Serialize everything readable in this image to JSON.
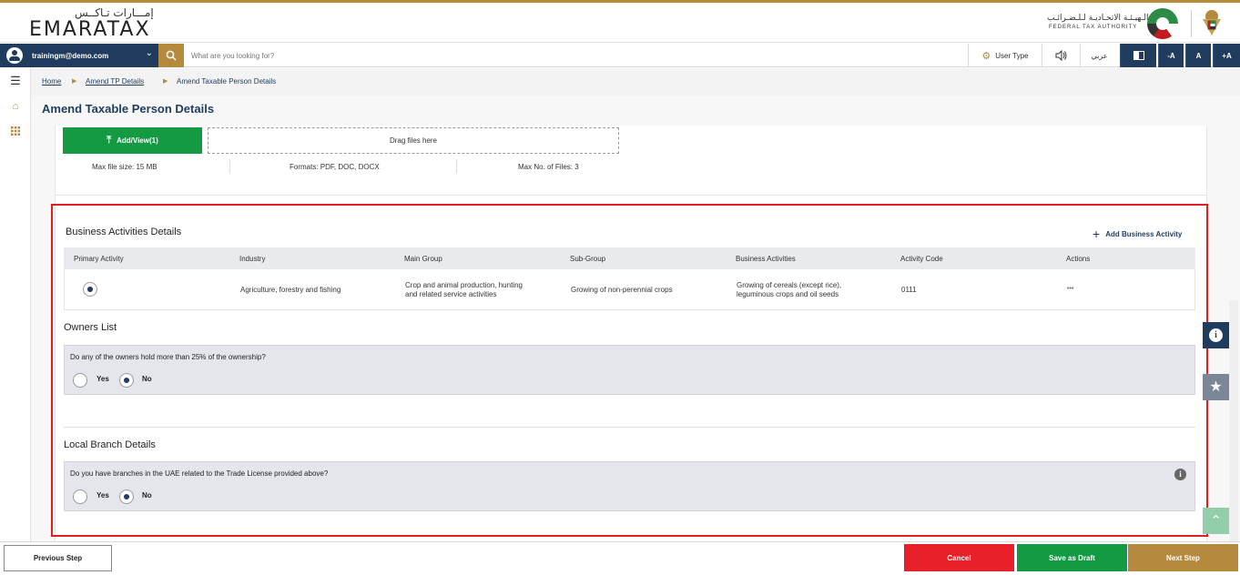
{
  "header": {
    "logo_ar": "إمـــارات تـاكــس",
    "logo_en": "EMARATAX",
    "fta_ar": "الـهيـئـة الاتحـاديـة لـلـضـرائـب",
    "fta_en": "FEDERAL TAX AUTHORITY"
  },
  "navbar": {
    "user_email": "trainingm@demo.com",
    "search_placeholder": "What are you looking for?",
    "user_type_label": "User Type",
    "arabic_label": "عربي",
    "font_decrease": "-A",
    "font_normal": "A",
    "font_increase": "+A"
  },
  "breadcrumb": {
    "home": "Home",
    "amend_tp": "Amend TP Details",
    "current": "Amend Taxable Person Details"
  },
  "page": {
    "title": "Amend Taxable Person Details"
  },
  "upload": {
    "button_label": "Add/View(1)",
    "drop_text": "Drag files here",
    "max_size": "Max file size: 15 MB",
    "formats": "Formats: PDF, DOC, DOCX",
    "max_files": "Max No. of Files: 3"
  },
  "business": {
    "title": "Business Activities Details",
    "add_label": "Add Business Activity",
    "columns": [
      "Primary Activity",
      "Industry",
      "Main Group",
      "Sub-Group",
      "Business Activities",
      "Activity Code",
      "Actions"
    ],
    "row": {
      "primary_selected": true,
      "industry": "Agriculture, forestry and fishing",
      "main_group_1": "Crop and animal production, hunting",
      "main_group_2": "and related service activities",
      "sub_group": "Growing of non-perennial crops",
      "activities_1": "Growing of cereals (except rice),",
      "activities_2": "leguminous crops and oil seeds",
      "code": "0111",
      "actions": "•••"
    }
  },
  "owners": {
    "title": "Owners List",
    "question": "Do any of the owners hold more than 25% of the ownership?",
    "yes": "Yes",
    "no": "No",
    "selected": "No"
  },
  "branch": {
    "title": "Local Branch Details",
    "question": "Do you have branches in the UAE related to the Trade License provided above?",
    "yes": "Yes",
    "no": "No",
    "selected": "No"
  },
  "footer": {
    "previous": "Previous Step",
    "cancel": "Cancel",
    "save_draft": "Save as Draft",
    "next": "Next Step"
  },
  "colors": {
    "navy": "#1f3c5f",
    "gold": "#b58a3c",
    "green": "#139a43",
    "red": "#e8202a",
    "highlight": "#e02020"
  }
}
